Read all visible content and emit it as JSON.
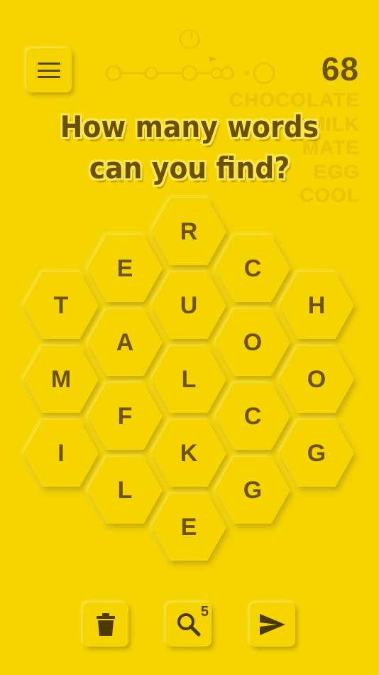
{
  "header": {
    "score": "68"
  },
  "banner": {
    "line1": "How many words",
    "line2": "can you find?"
  },
  "found_words": [
    "CHOCOLATE",
    "MILK",
    "MATE",
    "EGG",
    "COOL"
  ],
  "board": {
    "tiles": [
      {
        "letter": "R"
      },
      {
        "letter": "E"
      },
      {
        "letter": "C"
      },
      {
        "letter": "T"
      },
      {
        "letter": "U"
      },
      {
        "letter": "H"
      },
      {
        "letter": "A"
      },
      {
        "letter": "O"
      },
      {
        "letter": "M"
      },
      {
        "letter": "L"
      },
      {
        "letter": "O"
      },
      {
        "letter": "F"
      },
      {
        "letter": "C"
      },
      {
        "letter": "I"
      },
      {
        "letter": "K"
      },
      {
        "letter": "G"
      },
      {
        "letter": "L"
      },
      {
        "letter": "G"
      },
      {
        "letter": "E"
      }
    ]
  },
  "toolbar": {
    "menu_icon": "hamburger-menu-icon",
    "delete_icon": "trash-icon",
    "hint_icon": "search-icon",
    "hint_count": "5",
    "send_icon": "send-icon"
  },
  "colors": {
    "background": "#F5D400",
    "text": "#6b5300",
    "faded_word": "#EBC500"
  }
}
